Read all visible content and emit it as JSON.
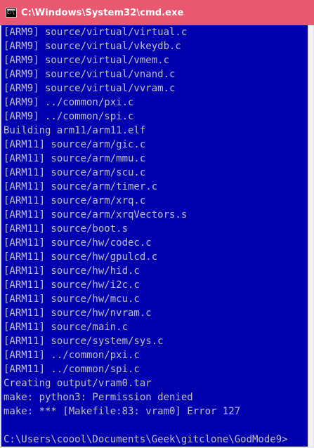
{
  "window": {
    "title": "C:\\Windows\\System32\\cmd.exe"
  },
  "console": {
    "lines": [
      "[ARM9] source/virtual/virtual.c",
      "[ARM9] source/virtual/vkeydb.c",
      "[ARM9] source/virtual/vmem.c",
      "[ARM9] source/virtual/vnand.c",
      "[ARM9] source/virtual/vvram.c",
      "[ARM9] ../common/pxi.c",
      "[ARM9] ../common/spi.c",
      "Building arm11/arm11.elf",
      "[ARM11] source/arm/gic.c",
      "[ARM11] source/arm/mmu.c",
      "[ARM11] source/arm/scu.c",
      "[ARM11] source/arm/timer.c",
      "[ARM11] source/arm/xrq.c",
      "[ARM11] source/arm/xrqVectors.s",
      "[ARM11] source/boot.s",
      "[ARM11] source/hw/codec.c",
      "[ARM11] source/hw/gpulcd.c",
      "[ARM11] source/hw/hid.c",
      "[ARM11] source/hw/i2c.c",
      "[ARM11] source/hw/mcu.c",
      "[ARM11] source/hw/nvram.c",
      "[ARM11] source/main.c",
      "[ARM11] source/system/sys.c",
      "[ARM11] ../common/pxi.c",
      "[ARM11] ../common/spi.c",
      "Creating output/vram0.tar",
      "make: python3: Permission denied",
      "make: *** [Makefile:83: vram0] Error 127",
      "",
      "C:\\Users\\coool\\Documents\\Geek\\gitclone\\GodMode9>"
    ]
  },
  "colors": {
    "titlebar": "#e85870",
    "console_bg": "#0000ae",
    "console_text": "#c0c0c0"
  }
}
